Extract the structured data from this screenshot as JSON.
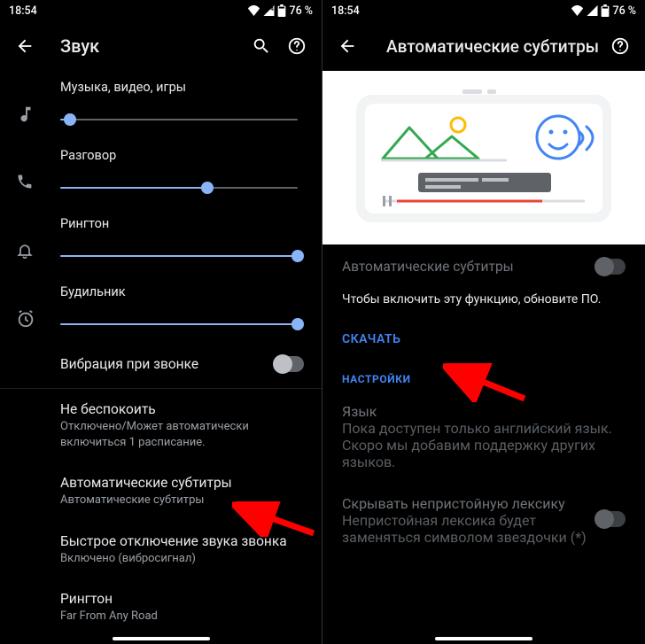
{
  "status": {
    "time": "18:54",
    "battery_pct": "76 %"
  },
  "left": {
    "title": "Звук",
    "sliders": {
      "media": {
        "label": "Музыка, видео, игры",
        "pct": 4
      },
      "call": {
        "label": "Разговор",
        "pct": 62
      },
      "ring": {
        "label": "Рингтон",
        "pct": 100
      },
      "alarm": {
        "label": "Будильник",
        "pct": 100
      }
    },
    "vibrate_on_ring": "Вибрация при звонке",
    "items": [
      {
        "primary": "Не беспокоить",
        "secondary": "Отключено/Может автоматически включиться 1 расписание."
      },
      {
        "primary": "Автоматические субтитры",
        "secondary": "Автоматические субтитры"
      },
      {
        "primary": "Быстрое отключение звука звонка",
        "secondary": "Включено (вибросигнал)"
      },
      {
        "primary": "Рингтон",
        "secondary": "Far From Any Road"
      }
    ]
  },
  "right": {
    "title": "Автоматические субтитры",
    "toggle_label": "Автоматические субтитры",
    "message": "Чтобы включить эту функцию, обновите ПО.",
    "download": "СКАЧАТЬ",
    "settings_header": "НАСТРОЙКИ",
    "items": [
      {
        "primary": "Язык",
        "secondary": "Пока доступен только английский язык. Скоро мы добавим поддержку других языков."
      },
      {
        "primary": "Скрывать непристойную лексику",
        "secondary": "Непристойная лексика будет заменяться символом звездочки (*)"
      }
    ]
  }
}
